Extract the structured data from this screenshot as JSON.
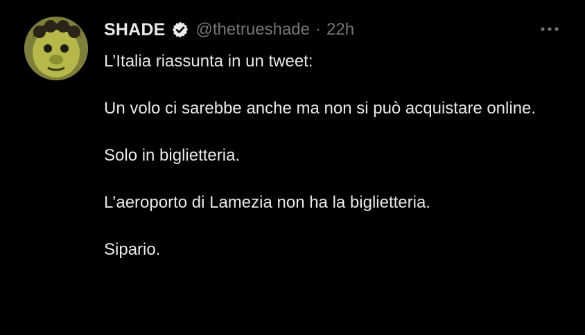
{
  "tweet": {
    "author": {
      "display_name": "SHADE",
      "handle": "@thetrueshade",
      "verified": true,
      "avatar_icon": "avatar-icon"
    },
    "separator": "·",
    "timestamp": "22h",
    "more_icon": "more-options-icon",
    "paragraphs": [
      "L’Italia riassunta in un tweet:",
      "Un volo ci sarebbe anche ma non si può acquistare online.",
      "Solo in biglietteria.",
      "L’aeroporto di Lamezia non ha la biglietteria.",
      "Sipario."
    ]
  },
  "colors": {
    "background": "#000000",
    "text": "#e7e9ea",
    "secondary_text": "#71767b",
    "verified_badge": "#e7e9ea"
  }
}
